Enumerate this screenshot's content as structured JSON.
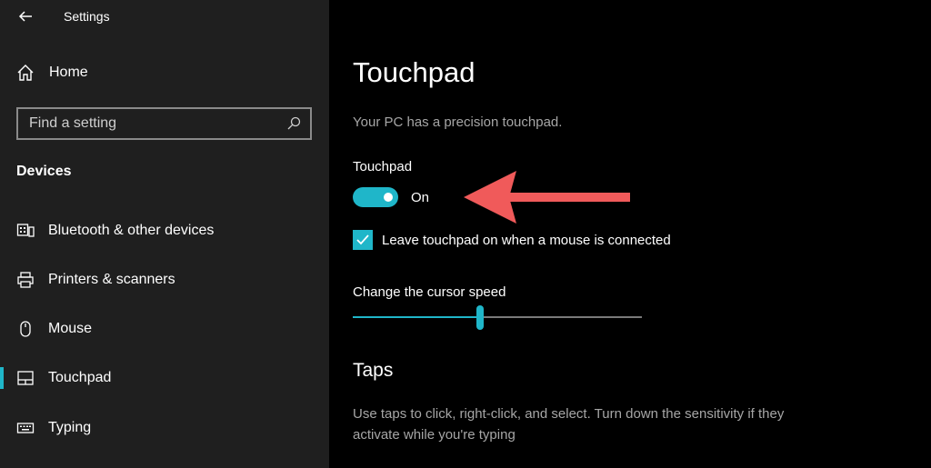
{
  "app": {
    "title": "Settings"
  },
  "sidebar": {
    "home_label": "Home",
    "search": {
      "placeholder": "Find a setting",
      "value": ""
    },
    "section": "Devices",
    "items": [
      {
        "label": "Bluetooth & other devices",
        "icon": "bluetooth-devices-icon"
      },
      {
        "label": "Printers & scanners",
        "icon": "printer-icon"
      },
      {
        "label": "Mouse",
        "icon": "mouse-icon"
      },
      {
        "label": "Touchpad",
        "icon": "touchpad-icon",
        "active": true
      },
      {
        "label": "Typing",
        "icon": "keyboard-icon"
      }
    ]
  },
  "main": {
    "title": "Touchpad",
    "info": "Your PC has a precision touchpad.",
    "touchpad_toggle": {
      "label": "Touchpad",
      "state": "On",
      "on": true
    },
    "leave_on_checkbox": {
      "label": "Leave touchpad on when a mouse is connected",
      "checked": true
    },
    "cursor_speed": {
      "label": "Change the cursor speed",
      "value": 0.44
    },
    "taps": {
      "heading": "Taps",
      "description": "Use taps to click, right-click, and select. Turn down the sensitivity if they activate while you're typing"
    }
  },
  "colors": {
    "accent": "#1fb6c9",
    "annotation_arrow": "#f05a5a",
    "sidebar_bg": "#1f1f1f"
  }
}
